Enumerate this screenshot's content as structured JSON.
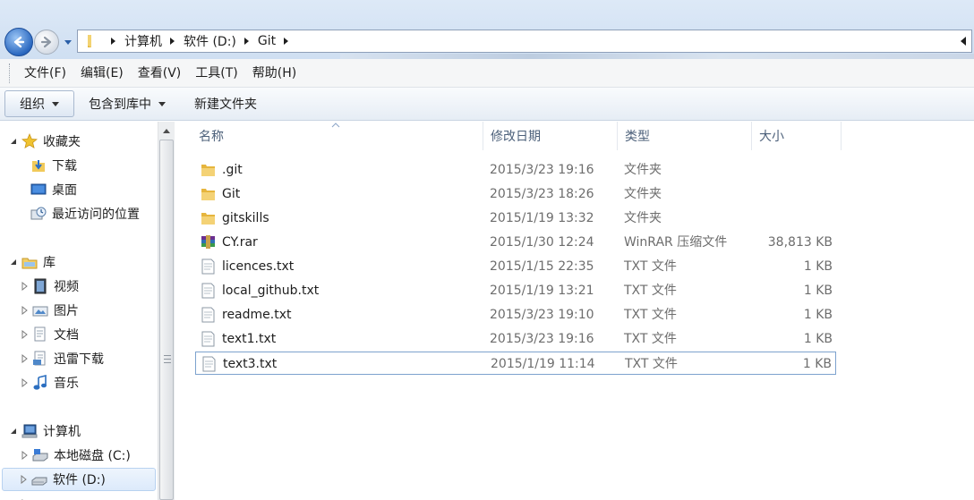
{
  "window": {
    "breadcrumbs": [
      "计算机",
      "软件 (D:)",
      "Git"
    ]
  },
  "menu": [
    "文件(F)",
    "编辑(E)",
    "查看(V)",
    "工具(T)",
    "帮助(H)"
  ],
  "toolbar": {
    "organize": "组织",
    "include_in_library": "包含到库中",
    "new_folder": "新建文件夹"
  },
  "nav": {
    "favorites": "收藏夹",
    "downloads": "下载",
    "desktop": "桌面",
    "recent": "最近访问的位置",
    "libraries": "库",
    "videos": "视频",
    "pictures": "图片",
    "documents": "文档",
    "thunder": "迅雷下载",
    "music": "音乐",
    "computer": "计算机",
    "drive_c": "本地磁盘 (C:)",
    "drive_d": "软件 (D:)"
  },
  "columns": {
    "name": "名称",
    "date": "修改日期",
    "type": "类型",
    "size": "大小"
  },
  "files": [
    {
      "name": ".git",
      "date": "2015/3/23 19:16",
      "type": "文件夹",
      "size": "",
      "icon": "folder-icon"
    },
    {
      "name": "Git",
      "date": "2015/3/23 18:26",
      "type": "文件夹",
      "size": "",
      "icon": "folder-icon"
    },
    {
      "name": "gitskills",
      "date": "2015/1/19 13:32",
      "type": "文件夹",
      "size": "",
      "icon": "folder-icon"
    },
    {
      "name": "CY.rar",
      "date": "2015/1/30 12:24",
      "type": "WinRAR 压缩文件",
      "size": "38,813 KB",
      "icon": "winrar-archive-icon"
    },
    {
      "name": "licences.txt",
      "date": "2015/1/15 22:35",
      "type": "TXT 文件",
      "size": "1 KB",
      "icon": "text-file-icon"
    },
    {
      "name": "local_github.txt",
      "date": "2015/1/19 13:21",
      "type": "TXT 文件",
      "size": "1 KB",
      "icon": "text-file-icon"
    },
    {
      "name": "readme.txt",
      "date": "2015/3/23 19:10",
      "type": "TXT 文件",
      "size": "1 KB",
      "icon": "text-file-icon"
    },
    {
      "name": "text1.txt",
      "date": "2015/3/23 19:16",
      "type": "TXT 文件",
      "size": "1 KB",
      "icon": "text-file-icon"
    },
    {
      "name": "text3.txt",
      "date": "2015/1/19 11:14",
      "type": "TXT 文件",
      "size": "1 KB",
      "icon": "text-file-icon"
    }
  ],
  "colors": {
    "selection_border": "#7da2ce",
    "header_text": "#4c607a",
    "detail_text": "#6d6d6d"
  }
}
